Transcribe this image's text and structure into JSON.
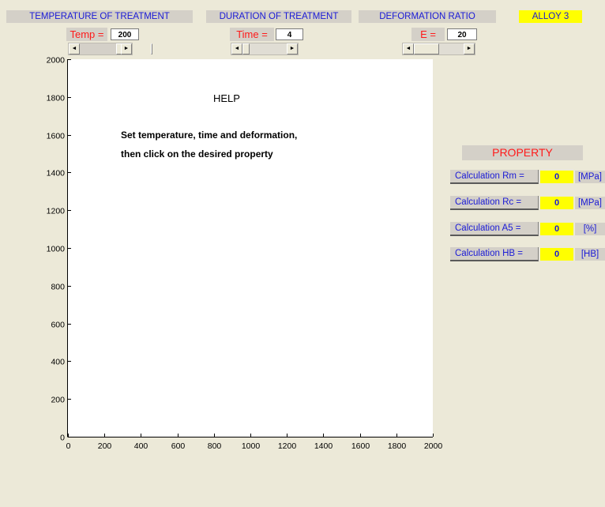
{
  "headers": {
    "temperature": "TEMPERATURE OF TREATMENT",
    "duration": "DURATION OF TREATMENT",
    "deformation": "DEFORMATION RATIO",
    "alloy": "ALLOY 3"
  },
  "params": {
    "temp_label": "Temp =",
    "temp_value": "200",
    "time_label": "Time =",
    "time_value": "4",
    "e_label": "E =",
    "e_value": "20"
  },
  "sliders": {
    "temp_position": 0.5,
    "time_position": 0.1,
    "e_position": 0.15,
    "arrow_left": "◄",
    "arrow_right": "►"
  },
  "plot": {
    "help_title": "HELP",
    "help_line1": "Set temperature, time and deformation,",
    "help_line2": "then click on the desired property"
  },
  "chart_data": {
    "type": "scatter",
    "xlim": [
      0,
      2000
    ],
    "ylim": [
      0,
      2000
    ],
    "x_ticks": [
      "0",
      "200",
      "400",
      "600",
      "800",
      "1000",
      "1200",
      "1400",
      "1600",
      "1800",
      "2000"
    ],
    "y_ticks": [
      "0",
      "200",
      "400",
      "600",
      "800",
      "1000",
      "1200",
      "1400",
      "1600",
      "1800",
      "2000"
    ]
  },
  "property": {
    "title": "PROPERTY",
    "rows": [
      {
        "label": "Calculation Rm =",
        "value": "0",
        "unit": "[MPa]"
      },
      {
        "label": "Calculation Rc =",
        "value": "0",
        "unit": "[MPa]"
      },
      {
        "label": "Calculation A5 =",
        "value": "0",
        "unit": "[%]"
      },
      {
        "label": "Calculation HB =",
        "value": "0",
        "unit": "[HB]"
      }
    ]
  }
}
